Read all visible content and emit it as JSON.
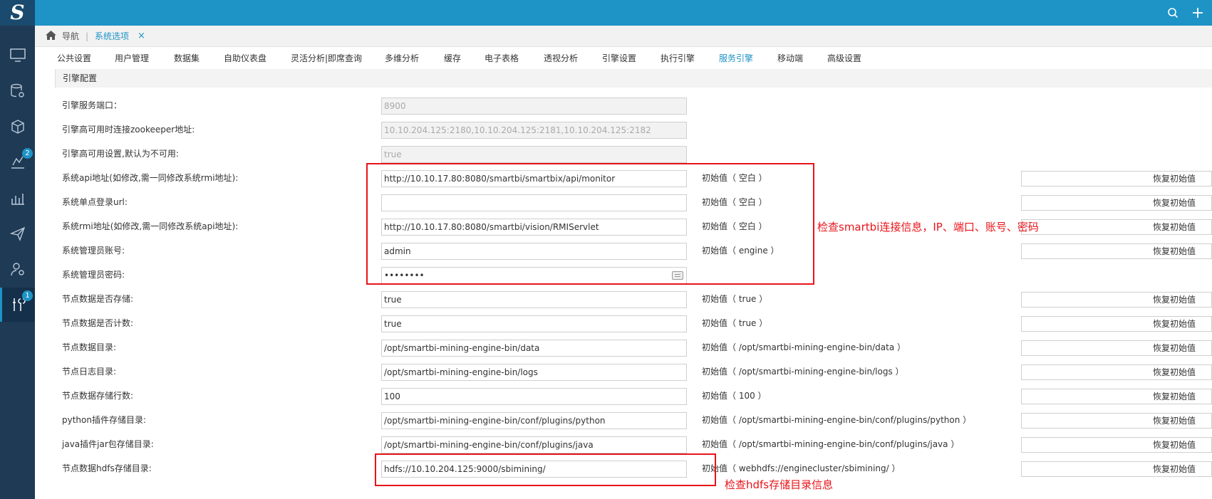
{
  "logo": "S",
  "topbar": {
    "icons": [
      "search-icon",
      "plus-icon"
    ]
  },
  "sidebar": {
    "items": [
      {
        "icon": "monitor-icon"
      },
      {
        "icon": "database-gear-icon"
      },
      {
        "icon": "cube-icon"
      },
      {
        "icon": "analysis-icon",
        "badge": "2"
      },
      {
        "icon": "bar-chart-icon"
      },
      {
        "icon": "paper-plane-icon"
      },
      {
        "icon": "user-settings-icon"
      },
      {
        "icon": "tools-icon",
        "badge": "1",
        "active": true
      }
    ]
  },
  "breadcrumb": {
    "home_label": "导航",
    "separator": "|",
    "current": "系统选项",
    "close": "×"
  },
  "tabs": [
    "公共设置",
    "用户管理",
    "数据集",
    "自助仪表盘",
    "灵活分析|即席查询",
    "多维分析",
    "缓存",
    "电子表格",
    "透视分析",
    "引擎设置",
    "执行引擎",
    "服务引擎",
    "移动端",
    "高级设置"
  ],
  "active_tab": "服务引擎",
  "section": {
    "title": "引擎配置"
  },
  "rows": [
    {
      "label": "引擎服务端口：",
      "value": "8900",
      "disabled": true
    },
    {
      "label": "引擎高可用时连接zookeeper地址:",
      "value": "10.10.204.125:2180,10.10.204.125:2181,10.10.204.125:2182",
      "disabled": true
    },
    {
      "label": "引擎高可用设置,默认为不可用:",
      "value": "true",
      "disabled": true
    },
    {
      "label": "系统api地址(如修改,需一同修改系统rmi地址):",
      "value": "http://10.10.17.80:8080/smartbi/smartbix/api/monitor",
      "initial": "初始值（ 空白 ）",
      "restore": "恢复初始值"
    },
    {
      "label": "系统单点登录url:",
      "value": "",
      "initial": "初始值（ 空白 ）",
      "restore": "恢复初始值"
    },
    {
      "label": "系统rmi地址(如修改,需一同修改系统api地址):",
      "value": "http://10.10.17.80:8080/smartbi/vision/RMIServlet",
      "initial": "初始值（ 空白 ）",
      "restore": "恢复初始值"
    },
    {
      "label": "系统管理员账号:",
      "value": "admin",
      "initial": "初始值（ engine ）",
      "restore": "恢复初始值"
    },
    {
      "label": "系统管理员密码:",
      "value": "••••••••",
      "password": true
    },
    {
      "label": "节点数据是否存储:",
      "value": "true",
      "initial": "初始值（ true ）",
      "restore": "恢复初始值"
    },
    {
      "label": "节点数据是否计数:",
      "value": "true",
      "initial": "初始值（ true ）",
      "restore": "恢复初始值"
    },
    {
      "label": "节点数据目录:",
      "value": "/opt/smartbi-mining-engine-bin/data",
      "initial": "初始值（ /opt/smartbi-mining-engine-bin/data ）",
      "restore": "恢复初始值"
    },
    {
      "label": "节点日志目录:",
      "value": "/opt/smartbi-mining-engine-bin/logs",
      "initial": "初始值（ /opt/smartbi-mining-engine-bin/logs ）",
      "restore": "恢复初始值"
    },
    {
      "label": "节点数据存储行数:",
      "value": "100",
      "initial": "初始值（ 100 ）",
      "restore": "恢复初始值"
    },
    {
      "label": "python插件存储目录:",
      "value": "/opt/smartbi-mining-engine-bin/conf/plugins/python",
      "initial": "初始值（ /opt/smartbi-mining-engine-bin/conf/plugins/python ）",
      "restore": "恢复初始值"
    },
    {
      "label": "java插件jar包存储目录:",
      "value": "/opt/smartbi-mining-engine-bin/conf/plugins/java",
      "initial": "初始值（ /opt/smartbi-mining-engine-bin/conf/plugins/java ）",
      "restore": "恢复初始值"
    },
    {
      "label": "节点数据hdfs存储目录:",
      "value": "hdfs://10.10.204.125:9000/sbimining/",
      "initial": "初始值（ webhdfs://enginecluster/sbimining/ ）",
      "restore": "恢复初始值"
    }
  ],
  "annotations": {
    "smartbi_note": "检查smartbi连接信息，IP、端口、账号、密码",
    "hdfs_note": "检查hdfs存储目录信息",
    "color": "#e8141a"
  },
  "colors": {
    "topbar": "#1e93c6",
    "sidebar": "#1e3a55",
    "accent": "#1e93c6"
  }
}
